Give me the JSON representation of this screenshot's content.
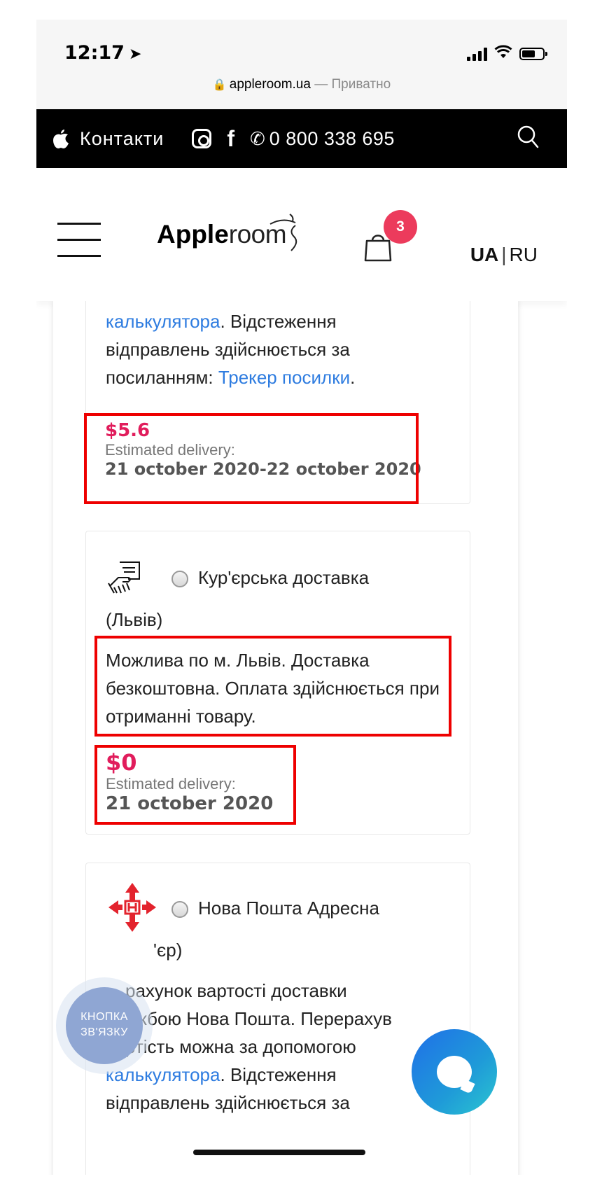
{
  "status": {
    "time": "12:17"
  },
  "browser": {
    "domain": "appleroom.ua",
    "separator": " — ",
    "mode": "Приватно"
  },
  "topbar": {
    "contacts_label": "Контакти",
    "facebook_label": "f",
    "phone": "0 800 338 695"
  },
  "header": {
    "logo_bold": "Apple",
    "logo_light": "room",
    "cart_count": "3",
    "lang_active": "UA",
    "lang_sep": "|",
    "lang_other": "RU"
  },
  "card1": {
    "calc_link": "калькулятора",
    "text_after_link": ". Відстеження відправлень здійснюється за посиланням: ",
    "tracker_link": "Трекер посилки",
    "text_end": ".",
    "price": "$5.6",
    "est_label": "Estimated delivery:",
    "date": "21 october 2020-22 october 2020"
  },
  "card2": {
    "title_line1": "Кур'єрська доставка",
    "title_line2": "(Львів)",
    "description": "Можлива по м. Львів. Доставка безкоштовна. Оплата здійснюється при отриманні товару.",
    "price": "$0",
    "est_label": "Estimated delivery:",
    "date": "21 october 2020"
  },
  "card3": {
    "title_line1": "Нова Пошта Адресна",
    "title_line2_partial": "'єр)",
    "text_line1": "рахунок вартості доставки",
    "text_line2": "службою Нова Пошта. Перерахув",
    "text_line3": "вартість можна за допомогою",
    "calc_link": "калькулятора",
    "text_after_link": ". Відстеження",
    "text_line5": "відправлень здійснюється за"
  },
  "contact_fab": {
    "line1": "КНОПКА",
    "line2": "ЗВ'ЯЗКУ"
  },
  "colors": {
    "accent": "#e11d5c",
    "link": "#2e7ce0",
    "badge": "#ec3b5c",
    "highlight": "#ee0000"
  }
}
